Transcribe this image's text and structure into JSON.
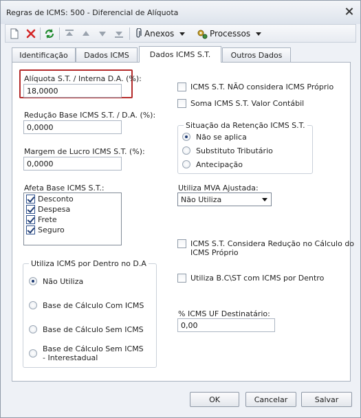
{
  "window": {
    "title": "Regras de ICMS: 500 - Diferencial de Alíquota"
  },
  "toolbar": {
    "items": [
      {
        "icon": "new-document-icon",
        "enabled": true
      },
      {
        "icon": "delete-x-icon",
        "enabled": true
      },
      {
        "icon": "refresh-icon",
        "enabled": true
      },
      {
        "icon": "move-first-icon",
        "enabled": false
      },
      {
        "icon": "move-up-icon",
        "enabled": false
      },
      {
        "icon": "move-down-icon",
        "enabled": false
      },
      {
        "icon": "move-last-icon",
        "enabled": false
      }
    ],
    "anexos_label": "Anexos",
    "processos_label": "Processos"
  },
  "tabs": [
    "Identificação",
    "Dados ICMS",
    "Dados ICMS S.T.",
    "Outros Dados"
  ],
  "active_tab": "Dados ICMS S.T.",
  "left": {
    "aliquota": {
      "label": "Alíquota S.T. / Interna D.A. (%):",
      "value": "18,0000"
    },
    "reducao": {
      "label": "Redução Base ICMS S.T. / D.A. (%):",
      "value": "0,0000"
    },
    "margem": {
      "label": "Margem de Lucro ICMS S.T. (%):",
      "value": "0,0000"
    },
    "afeta": {
      "label": "Afeta Base ICMS S.T.:",
      "items": [
        {
          "label": "Desconto",
          "checked": true
        },
        {
          "label": "Despesa",
          "checked": true
        },
        {
          "label": "Frete",
          "checked": true
        },
        {
          "label": "Seguro",
          "checked": true
        }
      ]
    },
    "utiliza_icms_dentro": {
      "title": "Utiliza ICMS por Dentro no D.A",
      "options": [
        {
          "label": "Não Utiliza",
          "selected": true
        },
        {
          "label": "Base de Cálculo Com ICMS",
          "selected": false
        },
        {
          "label": "Base de Cálculo Sem ICMS",
          "selected": false
        },
        {
          "label": "Base de Cálculo Sem ICMS - Interestadual",
          "selected": false
        }
      ]
    }
  },
  "right": {
    "nao_considera": {
      "label": "ICMS S.T. NÃO considera ICMS Próprio",
      "checked": false
    },
    "soma_valor": {
      "label": "Soma ICMS S.T. Valor Contábil",
      "checked": false
    },
    "situacao": {
      "title": "Situação da Retenção ICMS S.T.",
      "options": [
        {
          "label": "Não se aplica",
          "selected": true
        },
        {
          "label": "Substituto Tributário",
          "selected": false
        },
        {
          "label": "Antecipação",
          "selected": false
        }
      ]
    },
    "mva": {
      "label": "Utiliza MVA Ajustada:",
      "value": "Não Utiliza"
    },
    "considera_reducao": {
      "label": "ICMS S.T. Considera Redução no Cálculo do ICMS Próprio",
      "checked": false
    },
    "utiliza_bc": {
      "label": "Utiliza B.C\\ST com ICMS por Dentro",
      "checked": false
    },
    "uf_destinatario": {
      "label": "% ICMS UF Destinatário:",
      "value": "0,00"
    }
  },
  "buttons": {
    "ok": "OK",
    "cancel": "Cancelar",
    "save": "Salvar"
  },
  "colors": {
    "highlight": "#b42a2a",
    "window_bg": "#eef1f6",
    "accent": "#1d3a72"
  }
}
